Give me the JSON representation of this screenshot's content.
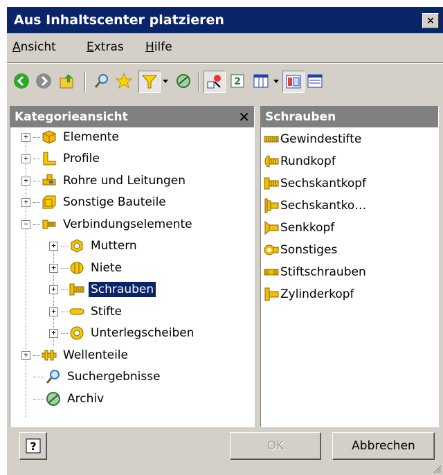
{
  "window": {
    "title": "Aus Inhaltscenter platzieren",
    "close_glyph": "×"
  },
  "menu": {
    "items": [
      {
        "label": "Ansicht",
        "mnemonic": "A"
      },
      {
        "label": "Extras",
        "mnemonic": "E"
      },
      {
        "label": "Hilfe",
        "mnemonic": "H"
      }
    ]
  },
  "toolbar": {
    "buttons": [
      "back-icon",
      "forward-icon",
      "up-folder-icon",
      "search-icon",
      "favorites-star-icon",
      "filter-icon",
      "dropdown-arrow-icon",
      "refresh-globe-icon",
      "select-component-icon",
      "update-icon",
      "table-view-icon",
      "dropdown-arrow-icon",
      "tree-view-icon",
      "list-view-icon"
    ]
  },
  "left_panel": {
    "title": "Kategorieansicht",
    "close_glyph": "✕",
    "tree": [
      {
        "label": "Elemente",
        "expander": "+",
        "icon": "cube-icon"
      },
      {
        "label": "Profile",
        "expander": "+",
        "icon": "profile-l-icon"
      },
      {
        "label": "Rohre und Leitungen",
        "expander": "+",
        "icon": "pipe-icon"
      },
      {
        "label": "Sonstige Bauteile",
        "expander": "+",
        "icon": "box-icon"
      },
      {
        "label": "Verbindungselemente",
        "expander": "−",
        "icon": "fastener-icon",
        "children": [
          {
            "label": "Muttern",
            "expander": "+",
            "icon": "nut-icon"
          },
          {
            "label": "Niete",
            "expander": "+",
            "icon": "rivet-icon"
          },
          {
            "label": "Schrauben",
            "expander": "+",
            "icon": "bolt-icon",
            "selected": true
          },
          {
            "label": "Stifte",
            "expander": "+",
            "icon": "pin-icon"
          },
          {
            "label": "Unterlegscheiben",
            "expander": "+",
            "icon": "washer-icon"
          }
        ]
      },
      {
        "label": "Wellenteile",
        "expander": "+",
        "icon": "shaft-icon"
      },
      {
        "label": "Suchergebnisse",
        "expander": "",
        "icon": "search-results-icon"
      },
      {
        "label": "Archiv",
        "expander": "",
        "icon": "archive-icon"
      }
    ]
  },
  "right_panel": {
    "title": "Schrauben",
    "items": [
      {
        "label": "Gewindestifte",
        "icon": "set-screw-icon"
      },
      {
        "label": "Rundkopf",
        "icon": "round-head-icon"
      },
      {
        "label": "Sechskantkopf",
        "icon": "hex-head-icon"
      },
      {
        "label": "Sechskantko…",
        "icon": "hex-head-flange-icon"
      },
      {
        "label": "Senkkopf",
        "icon": "countersunk-icon"
      },
      {
        "label": "Sonstiges",
        "icon": "misc-screw-icon"
      },
      {
        "label": "Stiftschrauben",
        "icon": "stud-icon"
      },
      {
        "label": "Zylinderkopf",
        "icon": "cylinder-head-icon"
      }
    ]
  },
  "footer": {
    "help_glyph": "?",
    "ok_label": "OK",
    "cancel_label": "Abbrechen"
  },
  "colors": {
    "titlebar": "#0a246a",
    "dialog": "#d4d0c8",
    "panel_header": "#808080",
    "selection": "#0a246a",
    "fastener_gold": "#f0c000"
  }
}
